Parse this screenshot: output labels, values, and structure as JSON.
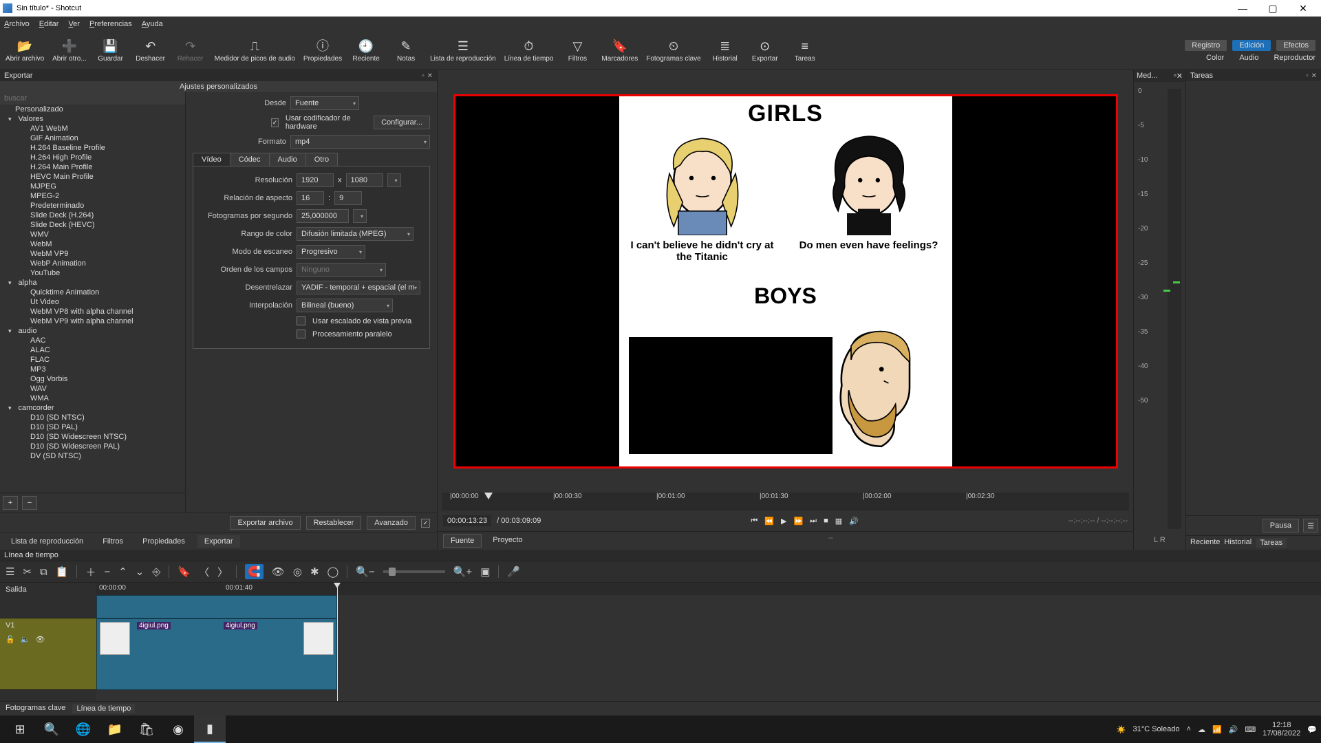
{
  "title": "Sin título* - Shotcut",
  "menu": [
    "Archivo",
    "Editar",
    "Ver",
    "Preferencias",
    "Ayuda"
  ],
  "toolbar": [
    {
      "icon": "📂",
      "label": "Abrir archivo"
    },
    {
      "icon": "➕",
      "label": "Abrir otro..."
    },
    {
      "icon": "💾",
      "label": "Guardar"
    },
    {
      "icon": "↶",
      "label": "Deshacer"
    },
    {
      "icon": "↷",
      "label": "Rehacer",
      "disabled": true
    },
    {
      "icon": "⎍",
      "label": "Medidor de picos de audio"
    },
    {
      "icon": "ⓘ",
      "label": "Propiedades"
    },
    {
      "icon": "🕘",
      "label": "Reciente"
    },
    {
      "icon": "✎",
      "label": "Notas"
    },
    {
      "icon": "☰",
      "label": "Lista de reproducción"
    },
    {
      "icon": "⏱",
      "label": "Línea de tiempo"
    },
    {
      "icon": "▽",
      "label": "Filtros"
    },
    {
      "icon": "🔖",
      "label": "Marcadores"
    },
    {
      "icon": "⏲",
      "label": "Fotogramas clave"
    },
    {
      "icon": "≣",
      "label": "Historial"
    },
    {
      "icon": "⊙",
      "label": "Exportar"
    },
    {
      "icon": "≡",
      "label": "Tareas"
    }
  ],
  "toolbar_right": {
    "row1": [
      {
        "t": "Registro"
      },
      {
        "t": "Edición",
        "active": true
      },
      {
        "t": "Efectos"
      }
    ],
    "row2": [
      {
        "t": "Color"
      },
      {
        "t": "Audio"
      },
      {
        "t": "Reproductor"
      }
    ]
  },
  "exportar": {
    "title": "Exportar",
    "ajustes": "Ajustes personalizados",
    "search_ph": "buscar",
    "tree": [
      {
        "t": "Personalizado",
        "top": true
      },
      {
        "t": "Valores",
        "cat": true
      },
      {
        "t": "AV1 WebM"
      },
      {
        "t": "GIF Animation"
      },
      {
        "t": "H.264 Baseline Profile"
      },
      {
        "t": "H.264 High Profile"
      },
      {
        "t": "H.264 Main Profile"
      },
      {
        "t": "HEVC Main Profile"
      },
      {
        "t": "MJPEG"
      },
      {
        "t": "MPEG-2"
      },
      {
        "t": "Predeterminado"
      },
      {
        "t": "Slide Deck (H.264)"
      },
      {
        "t": "Slide Deck (HEVC)"
      },
      {
        "t": "WMV"
      },
      {
        "t": "WebM"
      },
      {
        "t": "WebM VP9"
      },
      {
        "t": "WebP Animation"
      },
      {
        "t": "YouTube"
      },
      {
        "t": "alpha",
        "cat": true
      },
      {
        "t": "Quicktime Animation"
      },
      {
        "t": "Ut Video"
      },
      {
        "t": "WebM VP8 with alpha channel"
      },
      {
        "t": "WebM VP9 with alpha channel"
      },
      {
        "t": "audio",
        "cat": true
      },
      {
        "t": "AAC"
      },
      {
        "t": "ALAC"
      },
      {
        "t": "FLAC"
      },
      {
        "t": "MP3"
      },
      {
        "t": "Ogg Vorbis"
      },
      {
        "t": "WAV"
      },
      {
        "t": "WMA"
      },
      {
        "t": "camcorder",
        "cat": true
      },
      {
        "t": "D10 (SD NTSC)"
      },
      {
        "t": "D10 (SD PAL)"
      },
      {
        "t": "D10 (SD Widescreen NTSC)"
      },
      {
        "t": "D10 (SD Widescreen PAL)"
      },
      {
        "t": "DV (SD NTSC)"
      }
    ],
    "settings": {
      "desde_l": "Desde",
      "desde": "Fuente",
      "usar_hw": "Usar codificador de hardware",
      "config": "Configurar...",
      "formato_l": "Formato",
      "formato": "mp4",
      "tabs": [
        "Vídeo",
        "Códec",
        "Audio",
        "Otro"
      ],
      "res_l": "Resolución",
      "res_w": "1920",
      "res_h": "1080",
      "x": "x",
      "asp_l": "Relación de aspecto",
      "asp_w": "16",
      "asp_h": "9",
      "colon": ":",
      "fps_l": "Fotogramas por segundo",
      "fps": "25,000000",
      "rango_l": "Rango de color",
      "rango": "Difusión limitada (MPEG)",
      "scan_l": "Modo de escaneo",
      "scan": "Progresivo",
      "orden_l": "Orden de los campos",
      "orden": "Ninguno",
      "deint_l": "Desentrelazar",
      "deint": "YADIF - temporal + espacial (el m",
      "interp_l": "Interpolación",
      "interp": "Bilineal (bueno)",
      "escala": "Usar escalado de vista previa",
      "paralelo": "Procesamiento paralelo"
    },
    "bottom": [
      "Exportar archivo",
      "Restablecer",
      "Avanzado"
    ],
    "tabs2": [
      "Lista de reproducción",
      "Filtros",
      "Propiedades",
      "Exportar"
    ]
  },
  "viewer": {
    "girls": "GIRLS",
    "boys": "BOYS",
    "cap_l": "I can't believe he didn't cry at the Titanic",
    "cap_r": "Do men even have feelings?",
    "ruler": [
      "00:00:00",
      "00:00:30",
      "00:01:00",
      "00:01:30",
      "00:02:00",
      "00:02:30"
    ],
    "tc_cur": "00:00:13:23",
    "tc_dur": "/ 00:03:09:09",
    "dashes": "--:--:--:-- / --:--:--:--",
    "tabs": [
      "Fuente",
      "Proyecto"
    ]
  },
  "meter": {
    "title": "Med...",
    "db": [
      "0",
      "-5",
      "-10",
      "-15",
      "-20",
      "-25",
      "-30",
      "-35",
      "-40",
      "-50"
    ],
    "lr": "L   R"
  },
  "tareas": {
    "title": "Tareas",
    "pausa": "Pausa",
    "tabs": [
      "Reciente",
      "Historial",
      "Tareas"
    ]
  },
  "timeline": {
    "title": "Línea de tiempo",
    "salida": "Salida",
    "v1": "V1",
    "ruler": [
      "00:00:00",
      "00:01:40"
    ],
    "clip": "4igiul.png",
    "tabs": [
      "Fotogramas clave",
      "Línea de tiempo"
    ]
  },
  "taskbar": {
    "weather": "31°C  Soleado",
    "time": "12:18",
    "date": "17/08/2022"
  }
}
